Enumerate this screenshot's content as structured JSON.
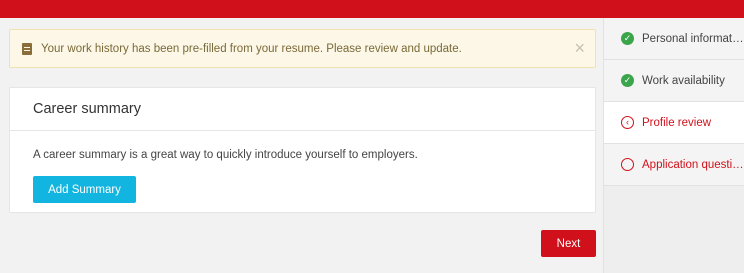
{
  "banner": {
    "message": "Your work history has been pre-filled from your resume. Please review and update.",
    "close_symbol": "×",
    "icon": "document-icon"
  },
  "career_summary": {
    "title": "Career summary",
    "description": "A career summary is a great way to quickly introduce yourself to employers.",
    "add_button_label": "Add Summary"
  },
  "actions": {
    "next_label": "Next"
  },
  "sidebar": {
    "steps": [
      {
        "label": "Personal information",
        "status": "complete",
        "icon": "check-circle-icon",
        "glyph": "✓"
      },
      {
        "label": "Work availability",
        "status": "complete",
        "icon": "check-circle-icon",
        "glyph": "✓"
      },
      {
        "label": "Profile review",
        "status": "current",
        "icon": "chevron-circle-icon",
        "glyph": "‹"
      },
      {
        "label": "Application questio...",
        "status": "pending",
        "icon": "empty-circle-icon",
        "glyph": ""
      }
    ]
  },
  "colors": {
    "brand_red": "#d0111b",
    "info_blue": "#11b5e0",
    "success_green": "#3aa54a",
    "banner_bg": "#fcf7e6"
  }
}
